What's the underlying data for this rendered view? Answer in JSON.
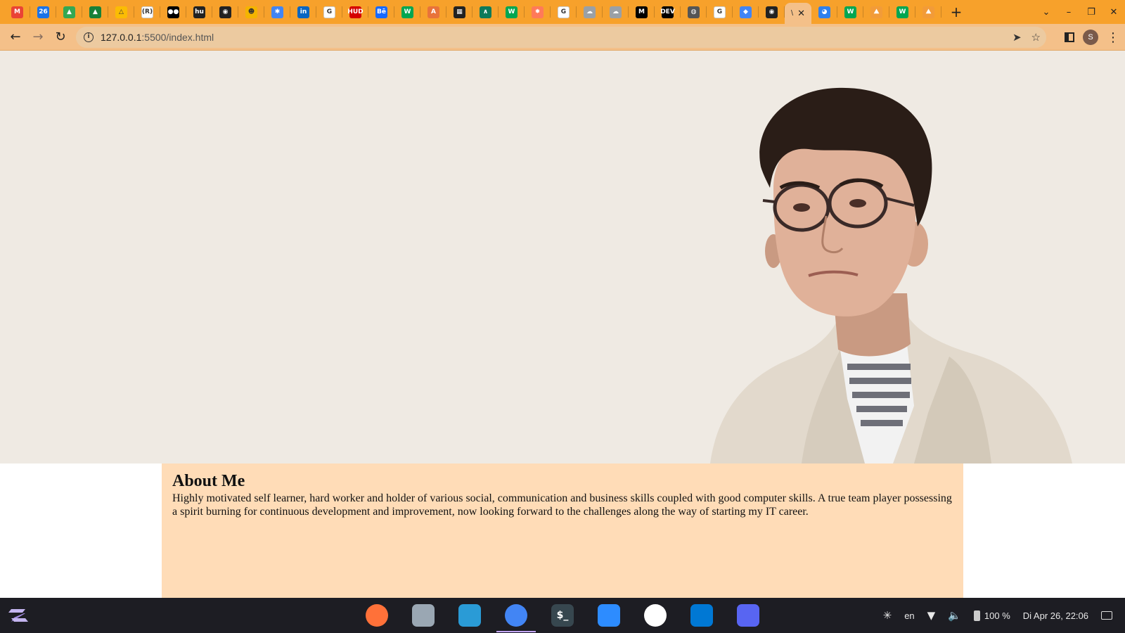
{
  "browser": {
    "tabs": [
      {
        "icon": "gmail-icon",
        "text": "M",
        "color": "#ea4335"
      },
      {
        "icon": "calendar-icon",
        "text": "26",
        "color": "#1a73e8"
      },
      {
        "icon": "google-classroom-icon",
        "text": "▲",
        "color": "#34a853"
      },
      {
        "icon": "google-classroom-icon",
        "text": "▲",
        "color": "#188038"
      },
      {
        "icon": "google-drive-icon",
        "text": "△",
        "color": "#fbbc04"
      },
      {
        "icon": "rocket-icon",
        "text": "(R)",
        "color": "#ffffff"
      },
      {
        "icon": "medium-icon",
        "text": "●●",
        "color": "#000000"
      },
      {
        "icon": "hu-icon",
        "text": "hu",
        "color": "#222222"
      },
      {
        "icon": "github-icon",
        "text": "◉",
        "color": "#222222"
      },
      {
        "icon": "emoji-icon",
        "text": "☻",
        "color": "#f4b400"
      },
      {
        "icon": "puzzle-icon",
        "text": "✱",
        "color": "#4285f4"
      },
      {
        "icon": "linkedin-icon",
        "text": "in",
        "color": "#0a66c2"
      },
      {
        "icon": "google-icon",
        "text": "G",
        "color": "#ffffff"
      },
      {
        "icon": "hubspot-red-icon",
        "text": "HUD",
        "color": "#d50000"
      },
      {
        "icon": "behance-icon",
        "text": "Bē",
        "color": "#1769ff"
      },
      {
        "icon": "w-icon",
        "text": "W",
        "color": "#00a651"
      },
      {
        "icon": "a-icon",
        "text": "A",
        "color": "#e8733a"
      },
      {
        "icon": "apps-icon",
        "text": "▦",
        "color": "#222222"
      },
      {
        "icon": "arc-icon",
        "text": "∧",
        "color": "#0e7a5a"
      },
      {
        "icon": "w-icon",
        "text": "W",
        "color": "#00a651"
      },
      {
        "icon": "hubspot-icon",
        "text": "✸",
        "color": "#ff7a59"
      },
      {
        "icon": "google-icon",
        "text": "G",
        "color": "#ffffff"
      },
      {
        "icon": "cloud-icon",
        "text": "☁",
        "color": "#9aa0a6"
      },
      {
        "icon": "cloud-icon",
        "text": "☁",
        "color": "#9aa0a6"
      },
      {
        "icon": "m-icon",
        "text": "M",
        "color": "#000000"
      },
      {
        "icon": "dev-icon",
        "text": "DEV",
        "color": "#000000"
      },
      {
        "icon": "globe-icon",
        "text": "◍",
        "color": "#555555"
      },
      {
        "icon": "google-icon",
        "text": "G",
        "color": "#ffffff"
      },
      {
        "icon": "maps-icon",
        "text": "◆",
        "color": "#4285f4"
      },
      {
        "icon": "github-icon",
        "text": "◉",
        "color": "#222222"
      }
    ],
    "active_tab": {
      "title": "\\",
      "close": "✕"
    },
    "tabs_after": [
      {
        "icon": "robot-icon",
        "text": "◕",
        "color": "#2f80ed"
      },
      {
        "icon": "w-icon",
        "text": "W",
        "color": "#00a651"
      },
      {
        "icon": "mountain-icon",
        "text": "⛰",
        "color": "#f29b38"
      },
      {
        "icon": "w-icon",
        "text": "W",
        "color": "#00a651"
      },
      {
        "icon": "mountain-icon",
        "text": "⛰",
        "color": "#f29b38"
      }
    ],
    "new_tab": "+",
    "window_controls": [
      "⌄",
      "–",
      "❐",
      "✕"
    ],
    "url_host": "127.0.0.1",
    "url_path": ":5500/index.html",
    "info_glyph": "i",
    "avatar_letter": "S"
  },
  "page": {
    "hero_bg": "#efeae3",
    "about": {
      "heading": "About Me",
      "text": "Highly motivated self learner, hard worker and holder of various social, communication and business skills coupled with good computer skills. A true team player possessing a spirit burning for continuous development and improvement, now looking forward to the challenges along the way of starting my IT career."
    }
  },
  "taskbar": {
    "apps": [
      {
        "name": "firefox-app",
        "label": "",
        "color": "#ff7139"
      },
      {
        "name": "files-app",
        "label": "",
        "color": "#9aa7b3"
      },
      {
        "name": "software-store-app",
        "label": "",
        "color": "#2a9bd6"
      },
      {
        "name": "chrome-app",
        "label": "",
        "color": "#4285f4"
      },
      {
        "name": "terminal-app",
        "label": "$_",
        "color": "#37474f"
      },
      {
        "name": "zoom-app",
        "label": "",
        "color": "#2d8cff"
      },
      {
        "name": "slack-app",
        "label": "",
        "color": "#ffffff"
      },
      {
        "name": "vscode-app",
        "label": "",
        "color": "#0078d4"
      },
      {
        "name": "discord-app",
        "label": "",
        "color": "#5865f2"
      }
    ],
    "lang": "en",
    "battery": "100 %",
    "datetime": "Di Apr 26, 22:06"
  }
}
